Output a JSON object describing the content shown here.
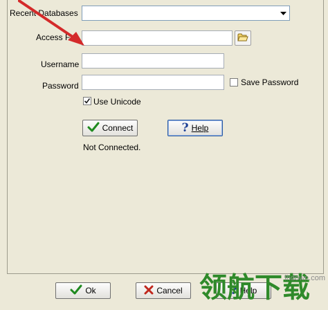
{
  "form": {
    "recent_databases_label": "Recent Databases",
    "recent_databases_value": "",
    "access_file_label": "Access Fi",
    "access_file_value": "",
    "username_label": "Username",
    "username_value": "",
    "password_label": "Password",
    "password_value": "",
    "save_password_label": "Save Password",
    "save_password_checked": false,
    "use_unicode_label": "Use Unicode",
    "use_unicode_checked": true,
    "connect_label": "Connect",
    "help_label": "Help",
    "status_text": "Not Connected."
  },
  "footer": {
    "ok_label": "Ok",
    "cancel_label": "Cancel",
    "help_label": "Help"
  },
  "watermark": {
    "chars": "领航下载",
    "site": "lhdown.com"
  },
  "icons": {
    "folder": "folder-open-icon",
    "dropdown": "chevron-down-icon",
    "check": "check-icon",
    "help": "question-icon",
    "cancel": "x-icon"
  },
  "colors": {
    "background": "#ece9d8",
    "arrow": "#d42a2a",
    "check_green": "#1f8a1f",
    "cancel_red": "#c0271d",
    "help_blue": "#1c3f95"
  }
}
